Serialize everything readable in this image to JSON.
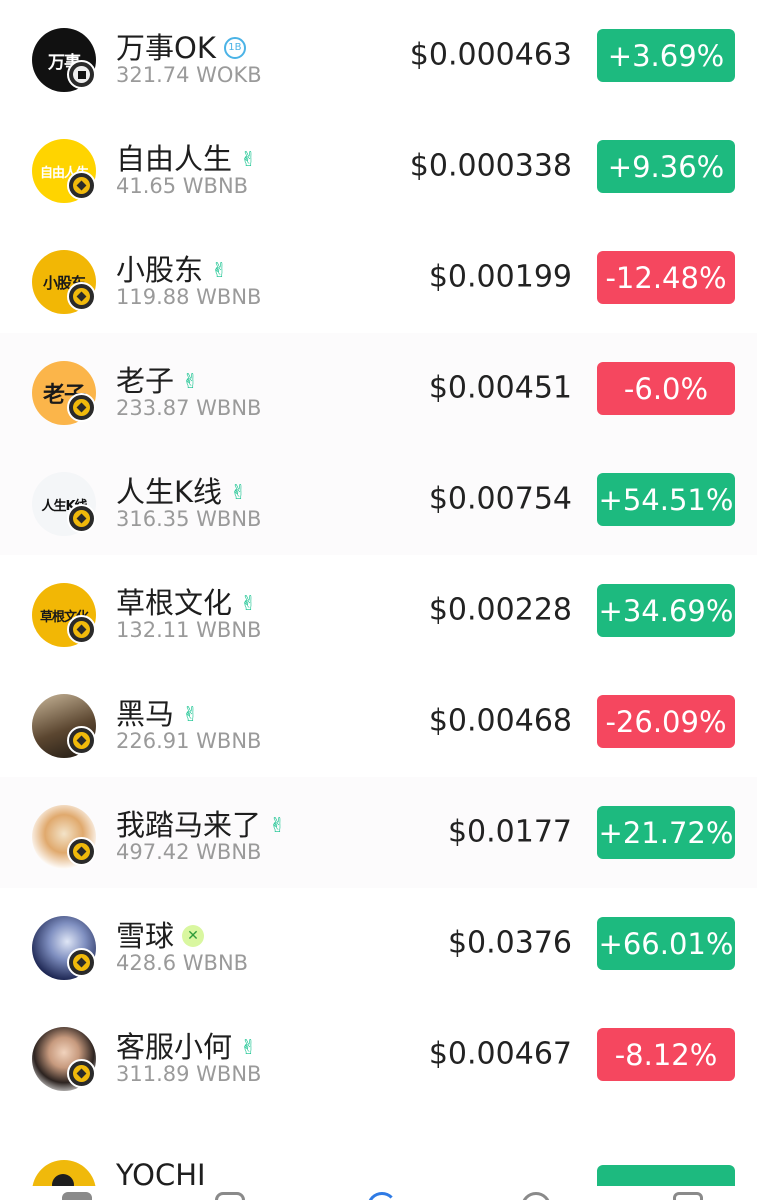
{
  "colors": {
    "up": "#1dba7f",
    "down": "#f5475f",
    "chain_bnb": "#f0b90b",
    "secondary_text": "#9a9a9a"
  },
  "tokens": [
    {
      "name": "万事OK",
      "avatar_text": "万事",
      "badge": "verified-icon",
      "chain": "okb",
      "liquidity": "321.74 WOKB",
      "price": "$0.000463",
      "change": "+3.69%",
      "direction": "up"
    },
    {
      "name": "自由人生",
      "avatar_text": "自由人生",
      "badge": "hand-icon",
      "chain": "bnb",
      "liquidity": "41.65 WBNB",
      "price": "$0.000338",
      "change": "+9.36%",
      "direction": "up"
    },
    {
      "name": "小股东",
      "avatar_text": "小股东",
      "badge": "hand-icon",
      "chain": "bnb",
      "liquidity": "119.88 WBNB",
      "price": "$0.00199",
      "change": "-12.48%",
      "direction": "down"
    },
    {
      "name": "老子",
      "avatar_text": "老子",
      "badge": "hand-icon",
      "chain": "bnb",
      "liquidity": "233.87 WBNB",
      "price": "$0.00451",
      "change": "-6.0%",
      "direction": "down"
    },
    {
      "name": "人生K线",
      "avatar_text": "人生K线",
      "badge": "hand-icon",
      "chain": "bnb",
      "liquidity": "316.35 WBNB",
      "price": "$0.00754",
      "change": "+54.51%",
      "direction": "up"
    },
    {
      "name": "草根文化",
      "avatar_text": "草根文化",
      "badge": "hand-icon",
      "chain": "bnb",
      "liquidity": "132.11 WBNB",
      "price": "$0.00228",
      "change": "+34.69%",
      "direction": "up"
    },
    {
      "name": "黑马",
      "avatar_text": "",
      "badge": "hand-icon",
      "chain": "bnb",
      "liquidity": "226.91 WBNB",
      "price": "$0.00468",
      "change": "-26.09%",
      "direction": "down"
    },
    {
      "name": "我踏马来了",
      "avatar_text": "",
      "badge": "hand-icon",
      "chain": "bnb",
      "liquidity": "497.42 WBNB",
      "price": "$0.0177",
      "change": "+21.72%",
      "direction": "up"
    },
    {
      "name": "雪球",
      "avatar_text": "",
      "badge": "x-icon",
      "chain": "bnb",
      "liquidity": "428.6 WBNB",
      "price": "$0.0376",
      "change": "+66.01%",
      "direction": "up"
    },
    {
      "name": "客服小何",
      "avatar_text": "",
      "badge": "hand-icon",
      "chain": "bnb",
      "liquidity": "311.89 WBNB",
      "price": "$0.00467",
      "change": "-8.12%",
      "direction": "down"
    }
  ],
  "partial_token": {
    "name": "YOCHI",
    "direction": "up"
  }
}
